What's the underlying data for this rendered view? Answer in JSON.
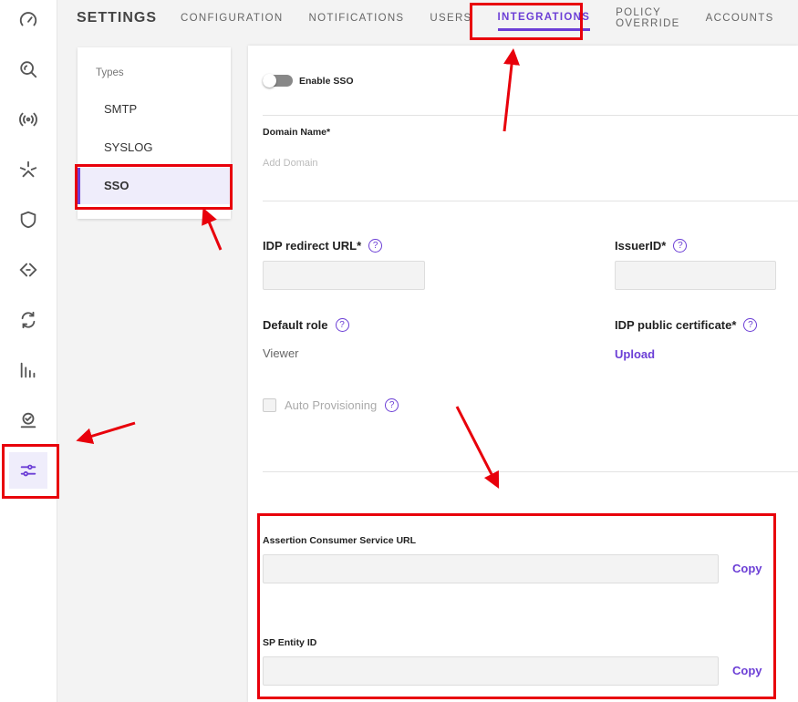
{
  "sidebar": {
    "icons": [
      "speedometer-icon",
      "search-icon",
      "broadcast-icon",
      "asterisk-icon",
      "shield-icon",
      "diamond-arrow-icon",
      "sync-icon",
      "bar-chart-icon",
      "approval-icon",
      "sliders-icon"
    ],
    "active": "sliders-icon"
  },
  "header": {
    "title": "SETTINGS",
    "tabs": [
      {
        "label": "CONFIGURATION"
      },
      {
        "label": "NOTIFICATIONS"
      },
      {
        "label": "USERS"
      },
      {
        "label": "INTEGRATIONS",
        "active": true
      },
      {
        "label": "POLICY OVERRIDE"
      },
      {
        "label": "ACCOUNTS"
      }
    ]
  },
  "types": {
    "label": "Types",
    "items": [
      {
        "label": "SMTP"
      },
      {
        "label": "SYSLOG"
      },
      {
        "label": "SSO",
        "active": true
      }
    ]
  },
  "form": {
    "enable_sso": "Enable SSO",
    "enable_sso_on": false,
    "domain_label": "Domain Name*",
    "domain_placeholder": "Add Domain",
    "idp_redirect_label": "IDP redirect URL*",
    "issuer_label": "IssuerID*",
    "default_role_label": "Default role",
    "default_role_value": "Viewer",
    "idp_cert_label": "IDP public certificate*",
    "upload": "Upload",
    "auto_prov": "Auto Provisioning",
    "help": "?",
    "acs_label": "Assertion Consumer Service URL",
    "sp_label": "SP Entity ID",
    "copy": "Copy"
  },
  "colors": {
    "accent": "#6c3fd6",
    "annotation": "#e8000b"
  }
}
